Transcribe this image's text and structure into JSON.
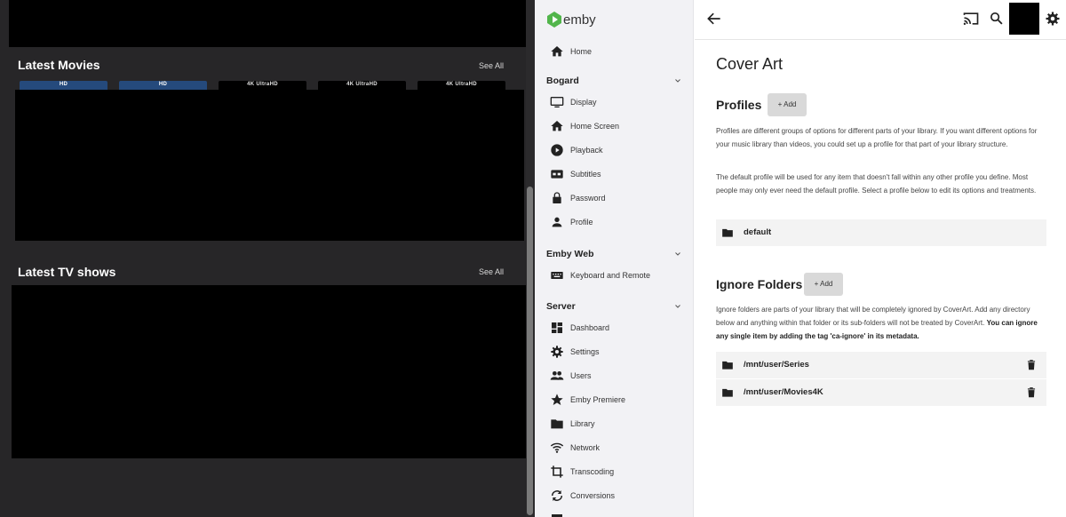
{
  "background": {
    "latest_movies_title": "Latest Movies",
    "latest_movies_see_all": "See All",
    "latest_tv_title": "Latest TV shows",
    "latest_tv_see_all": "See All",
    "poster_badges": [
      "HD",
      "HD",
      "4K UltraHD",
      "4K UltraHD",
      "4K UltraHD"
    ]
  },
  "sidebar": {
    "logo_text": "emby",
    "home_label": "Home",
    "groups": [
      {
        "title": "Bogard",
        "items": [
          {
            "label": "Display",
            "icon": "display-icon"
          },
          {
            "label": "Home Screen",
            "icon": "home-icon"
          },
          {
            "label": "Playback",
            "icon": "play-circle-icon"
          },
          {
            "label": "Subtitles",
            "icon": "closed-caption-icon"
          },
          {
            "label": "Password",
            "icon": "lock-icon"
          },
          {
            "label": "Profile",
            "icon": "person-icon"
          }
        ]
      },
      {
        "title": "Emby Web",
        "items": [
          {
            "label": "Keyboard and Remote",
            "icon": "keyboard-icon"
          }
        ]
      },
      {
        "title": "Server",
        "items": [
          {
            "label": "Dashboard",
            "icon": "dashboard-icon"
          },
          {
            "label": "Settings",
            "icon": "gear-icon"
          },
          {
            "label": "Users",
            "icon": "people-icon"
          },
          {
            "label": "Emby Premiere",
            "icon": "star-icon"
          },
          {
            "label": "Library",
            "icon": "folder-icon"
          },
          {
            "label": "Network",
            "icon": "wifi-icon"
          },
          {
            "label": "Transcoding",
            "icon": "crop-icon"
          },
          {
            "label": "Conversions",
            "icon": "sync-icon"
          }
        ]
      }
    ]
  },
  "main": {
    "page_title": "Cover Art",
    "profiles": {
      "heading": "Profiles",
      "add_label": "+ Add",
      "desc_1": "Profiles are different groups of options for different parts of your library. If you want different options for your music library than videos, you could set up a profile for that part of your library structure.",
      "desc_2": "The default profile will be used for any item that doesn't fall within any other profile you define. Most people may only ever need the default profile. Select a profile below to edit its options and treatments.",
      "items": [
        "default"
      ]
    },
    "ignore_folders": {
      "heading": "Ignore Folders",
      "add_label": "+ Add",
      "desc": "Ignore folders are parts of your library that will be completely ignored by CoverArt. Add any directory below and anything within that folder or its sub-folders will not be treated by CoverArt.",
      "desc_bold": "You can ignore any single item by adding the tag 'ca-ignore' in its metadata.",
      "items": [
        "/mnt/user/Series",
        "/mnt/user/Movies4K"
      ]
    }
  },
  "colors": {
    "brand_green": "#52b54b",
    "hd_badge": "#254a7c",
    "dark_bg": "#272628"
  }
}
